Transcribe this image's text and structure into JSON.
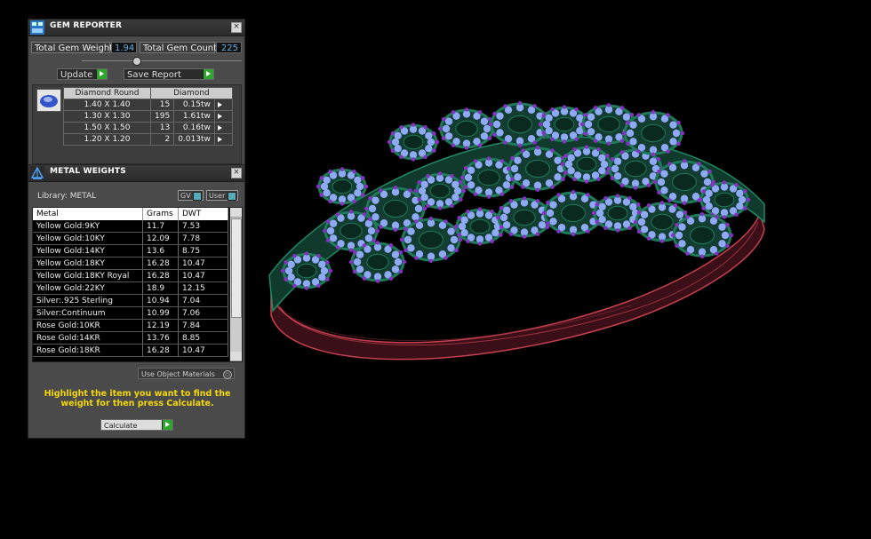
{
  "gem_reporter": {
    "title": "GEM REPORTER",
    "close": "×",
    "total_gem_weight_label": "Total Gem Weight",
    "total_gem_weight_value": "1.94",
    "total_gem_count_label": "Total Gem Count",
    "total_gem_count_value": "225",
    "update_label": "Update",
    "save_report_label": "Save Report",
    "table": {
      "headers": [
        "Diamond Round",
        "Diamond"
      ],
      "rows": [
        {
          "size": "1.40 X 1.40",
          "count": "15",
          "weight": "0.15tw"
        },
        {
          "size": "1.30 X 1.30",
          "count": "195",
          "weight": "1.61tw"
        },
        {
          "size": "1.50 X 1.50",
          "count": "13",
          "weight": "0.16tw"
        },
        {
          "size": "1.20 X 1.20",
          "count": "2",
          "weight": "0.013tw"
        }
      ]
    }
  },
  "metal_weights": {
    "title": "METAL WEIGHTS",
    "close": "×",
    "library_label": "Library:  METAL",
    "gv_label": "GV",
    "user_label": "User",
    "columns": [
      "Metal",
      "Grams",
      "DWT"
    ],
    "rows": [
      {
        "metal": "Yellow Gold:9KY",
        "grams": "11.7",
        "dwt": "7.53"
      },
      {
        "metal": "Yellow Gold:10KY",
        "grams": "12.09",
        "dwt": "7.78"
      },
      {
        "metal": "Yellow Gold:14KY",
        "grams": "13.6",
        "dwt": "8.75"
      },
      {
        "metal": "Yellow Gold:18KY",
        "grams": "16.28",
        "dwt": "10.47"
      },
      {
        "metal": "Yellow Gold:18KY Royal",
        "grams": "16.28",
        "dwt": "10.47"
      },
      {
        "metal": "Yellow Gold:22KY",
        "grams": "18.9",
        "dwt": "12.15"
      },
      {
        "metal": "Silver:.925 Sterling",
        "grams": "10.94",
        "dwt": "7.04"
      },
      {
        "metal": "Silver:Continuum",
        "grams": "10.99",
        "dwt": "7.06"
      },
      {
        "metal": "Rose Gold:10KR",
        "grams": "12.19",
        "dwt": "7.84"
      },
      {
        "metal": "Rose Gold:14KR",
        "grams": "13.76",
        "dwt": "8.85"
      },
      {
        "metal": "Rose Gold:18KR",
        "grams": "16.28",
        "dwt": "10.47"
      }
    ],
    "use_object_materials_label": "Use Object Materials",
    "hint": "Highlight the item you want to find the weight for then press Calculate.",
    "calculate_label": "Calculate"
  },
  "colors": {
    "panel_bg": "#4a4a4a",
    "accent_green": "#2fa52f",
    "hint_yellow": "#f4d70b",
    "band_red": "#c8404e",
    "setting_green": "#1f7a5a",
    "gem_blue": "#8ea9f5",
    "prong_purple": "#8a2fc6"
  }
}
